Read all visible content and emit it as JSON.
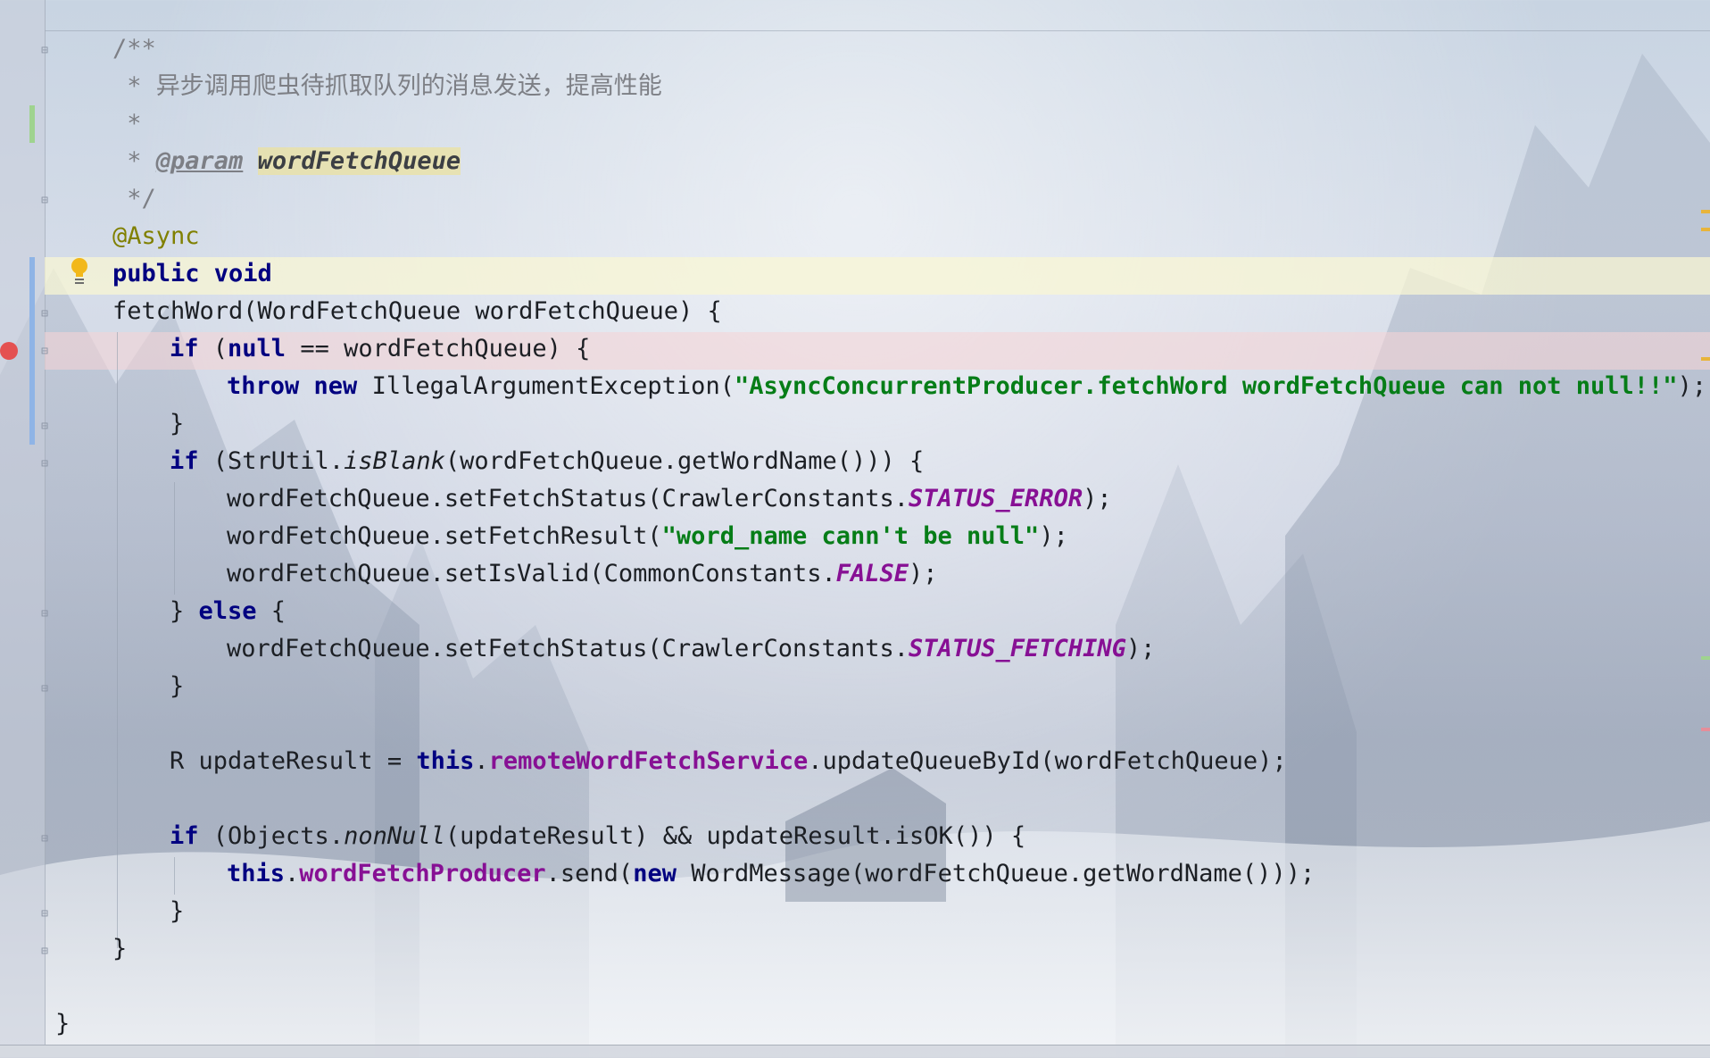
{
  "editor": {
    "lines": [
      {
        "indent": 0,
        "tokens": [
          {
            "t": "/**",
            "c": "cmt"
          }
        ]
      },
      {
        "indent": 0,
        "tokens": [
          {
            "t": " * 异步调用爬虫待抓取队列的消息发送，提高性能",
            "c": "cmt"
          }
        ]
      },
      {
        "indent": 0,
        "tokens": [
          {
            "t": " *",
            "c": "cmt"
          }
        ]
      },
      {
        "indent": 0,
        "tokens": [
          {
            "t": " * ",
            "c": "cmt"
          },
          {
            "t": "@param",
            "c": "tag"
          },
          {
            "t": " ",
            "c": "cmt"
          },
          {
            "t": "wordFetchQueue",
            "c": "param-ref"
          }
        ]
      },
      {
        "indent": 0,
        "tokens": [
          {
            "t": " */",
            "c": "cmt"
          }
        ]
      },
      {
        "indent": 0,
        "tokens": [
          {
            "t": "@Async",
            "c": "ann"
          }
        ]
      },
      {
        "indent": 0,
        "tokens": [
          {
            "t": "public void",
            "c": "kw"
          }
        ]
      },
      {
        "indent": 0,
        "tokens": [
          {
            "t": "fetchWord(WordFetchQueue wordFetchQueue) {",
            "c": "plain"
          }
        ]
      },
      {
        "indent": 1,
        "tokens": [
          {
            "t": "if",
            "c": "kw"
          },
          {
            "t": " (",
            "c": "plain"
          },
          {
            "t": "null",
            "c": "kw"
          },
          {
            "t": " == wordFetchQueue) {",
            "c": "plain"
          }
        ]
      },
      {
        "indent": 2,
        "tokens": [
          {
            "t": "throw new",
            "c": "kw"
          },
          {
            "t": " IllegalArgumentException(",
            "c": "plain"
          },
          {
            "t": "\"AsyncConcurrentProducer.fetchWord wordFetchQueue can not null!!\"",
            "c": "str"
          },
          {
            "t": ");",
            "c": "plain"
          }
        ]
      },
      {
        "indent": 1,
        "tokens": [
          {
            "t": "}",
            "c": "plain"
          }
        ]
      },
      {
        "indent": 1,
        "tokens": [
          {
            "t": "if",
            "c": "kw"
          },
          {
            "t": " (StrUtil.",
            "c": "plain"
          },
          {
            "t": "isBlank",
            "c": "sm"
          },
          {
            "t": "(wordFetchQueue.getWordName())) {",
            "c": "plain"
          }
        ]
      },
      {
        "indent": 2,
        "tokens": [
          {
            "t": "wordFetchQueue.setFetchStatus(CrawlerConstants.",
            "c": "plain"
          },
          {
            "t": "STATUS_ERROR",
            "c": "sfld"
          },
          {
            "t": ");",
            "c": "plain"
          }
        ]
      },
      {
        "indent": 2,
        "tokens": [
          {
            "t": "wordFetchQueue.setFetchResult(",
            "c": "plain"
          },
          {
            "t": "\"word_name cann't be null\"",
            "c": "str"
          },
          {
            "t": ");",
            "c": "plain"
          }
        ]
      },
      {
        "indent": 2,
        "tokens": [
          {
            "t": "wordFetchQueue.setIsValid(CommonConstants.",
            "c": "plain"
          },
          {
            "t": "FALSE",
            "c": "sfld"
          },
          {
            "t": ");",
            "c": "plain"
          }
        ]
      },
      {
        "indent": 1,
        "tokens": [
          {
            "t": "} ",
            "c": "plain"
          },
          {
            "t": "else",
            "c": "kw"
          },
          {
            "t": " {",
            "c": "plain"
          }
        ]
      },
      {
        "indent": 2,
        "tokens": [
          {
            "t": "wordFetchQueue.setFetchStatus(CrawlerConstants.",
            "c": "plain"
          },
          {
            "t": "STATUS_FETCHING",
            "c": "sfld"
          },
          {
            "t": ");",
            "c": "plain"
          }
        ]
      },
      {
        "indent": 1,
        "tokens": [
          {
            "t": "}",
            "c": "plain"
          }
        ]
      },
      {
        "indent": 1,
        "tokens": []
      },
      {
        "indent": 1,
        "tokens": [
          {
            "t": "R updateResult = ",
            "c": "plain"
          },
          {
            "t": "this",
            "c": "kw"
          },
          {
            "t": ".",
            "c": "plain"
          },
          {
            "t": "remoteWordFetchService",
            "c": "fld"
          },
          {
            "t": ".updateQueueById(wordFetchQueue);",
            "c": "plain"
          }
        ]
      },
      {
        "indent": 1,
        "tokens": []
      },
      {
        "indent": 1,
        "tokens": [
          {
            "t": "if",
            "c": "kw"
          },
          {
            "t": " (Objects.",
            "c": "plain"
          },
          {
            "t": "nonNull",
            "c": "sm"
          },
          {
            "t": "(updateResult) && updateResult.isOK()) {",
            "c": "plain"
          }
        ]
      },
      {
        "indent": 2,
        "tokens": [
          {
            "t": "this",
            "c": "kw"
          },
          {
            "t": ".",
            "c": "plain"
          },
          {
            "t": "wordFetchProducer",
            "c": "fld"
          },
          {
            "t": ".send(",
            "c": "plain"
          },
          {
            "t": "new",
            "c": "kw"
          },
          {
            "t": " WordMessage(wordFetchQueue.getWordName()));",
            "c": "plain"
          }
        ]
      },
      {
        "indent": 1,
        "tokens": [
          {
            "t": "}",
            "c": "plain"
          }
        ]
      },
      {
        "indent": 0,
        "tokens": [
          {
            "t": "}",
            "c": "plain"
          }
        ]
      },
      {
        "indent": 0,
        "tokens": []
      },
      {
        "indent": -1,
        "tokens": [
          {
            "t": "}",
            "c": "plain"
          }
        ]
      }
    ]
  },
  "colors": {
    "keyword": "#000080",
    "string": "#067d17",
    "field": "#871094",
    "comment": "#7d7f85",
    "annotation": "#808000",
    "breakpoint": "#e45151",
    "caret_line": "#faf6d2"
  }
}
